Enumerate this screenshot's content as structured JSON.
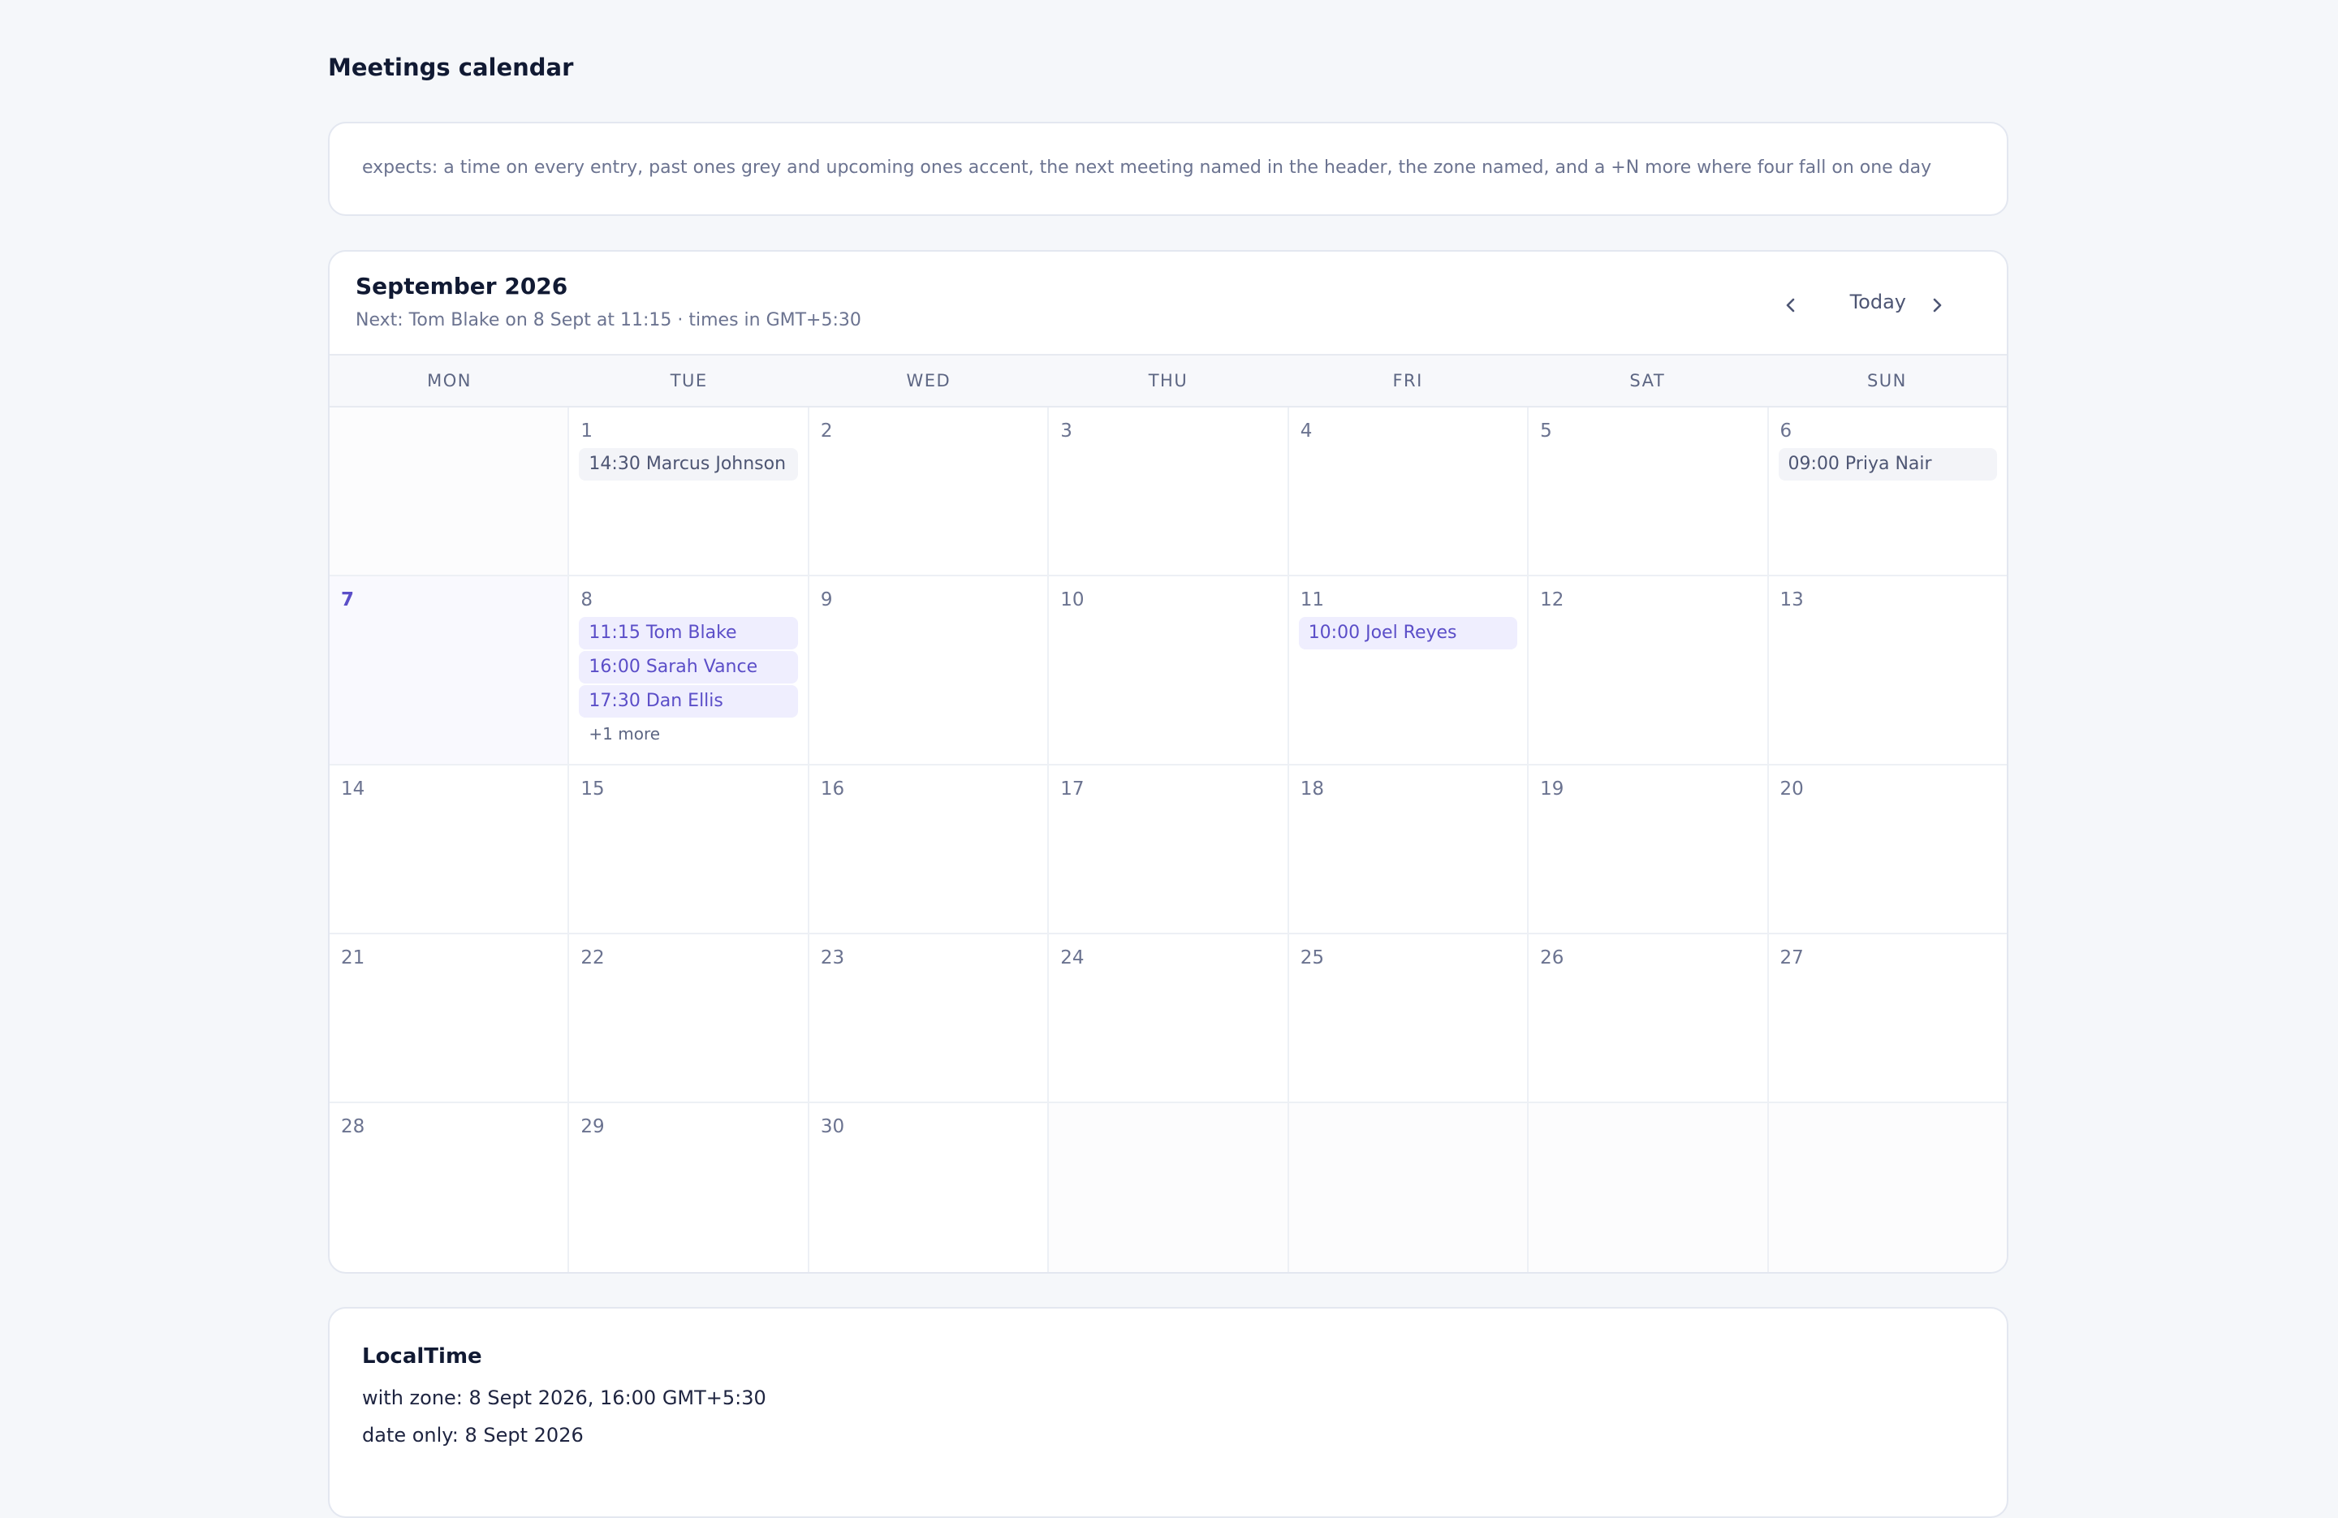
{
  "page": {
    "title": "Meetings calendar",
    "expects": "expects: a time on every entry, past ones grey and upcoming ones accent, the next meeting named in the header, the zone named, and a +N more where four fall on one day"
  },
  "calendar": {
    "month_title": "September 2026",
    "next_line": "Next: Tom Blake on 8 Sept at 11:15 · times in GMT+5:30",
    "nav": {
      "prev_icon": "chevron-left-icon",
      "today_label": "Today",
      "next_icon": "chevron-right-icon"
    },
    "weekdays": [
      "MON",
      "TUE",
      "WED",
      "THU",
      "FRI",
      "SAT",
      "SUN"
    ],
    "colors": {
      "accent": "#5b4ec8",
      "accent_bg": "#efeefe",
      "past_text": "#4d5573",
      "past_bg": "#f3f4f8"
    },
    "weeks": [
      [
        {
          "day": ""
        },
        {
          "day": "1",
          "events": [
            {
              "label": "14:30 Marcus Johnson",
              "state": "past"
            }
          ]
        },
        {
          "day": "2"
        },
        {
          "day": "3"
        },
        {
          "day": "4"
        },
        {
          "day": "5"
        },
        {
          "day": "6",
          "events": [
            {
              "label": "09:00 Priya Nair",
              "state": "past"
            }
          ]
        }
      ],
      [
        {
          "day": "7",
          "today": true
        },
        {
          "day": "8",
          "events": [
            {
              "label": "11:15 Tom Blake",
              "state": "upcoming"
            },
            {
              "label": "16:00 Sarah Vance",
              "state": "upcoming"
            },
            {
              "label": "17:30 Dan Ellis",
              "state": "upcoming"
            }
          ],
          "more": "+1 more"
        },
        {
          "day": "9"
        },
        {
          "day": "10"
        },
        {
          "day": "11",
          "events": [
            {
              "label": "10:00 Joel Reyes",
              "state": "upcoming"
            }
          ]
        },
        {
          "day": "12"
        },
        {
          "day": "13"
        }
      ],
      [
        {
          "day": "14"
        },
        {
          "day": "15"
        },
        {
          "day": "16"
        },
        {
          "day": "17"
        },
        {
          "day": "18"
        },
        {
          "day": "19"
        },
        {
          "day": "20"
        }
      ],
      [
        {
          "day": "21"
        },
        {
          "day": "22"
        },
        {
          "day": "23"
        },
        {
          "day": "24"
        },
        {
          "day": "25"
        },
        {
          "day": "26"
        },
        {
          "day": "27"
        }
      ],
      [
        {
          "day": "28"
        },
        {
          "day": "29"
        },
        {
          "day": "30"
        },
        {
          "day": ""
        },
        {
          "day": ""
        },
        {
          "day": ""
        },
        {
          "day": ""
        }
      ]
    ]
  },
  "localtime": {
    "title": "LocalTime",
    "with_zone": "with zone: 8 Sept 2026, 16:00 GMT+5:30",
    "date_only": "date only: 8 Sept 2026"
  }
}
